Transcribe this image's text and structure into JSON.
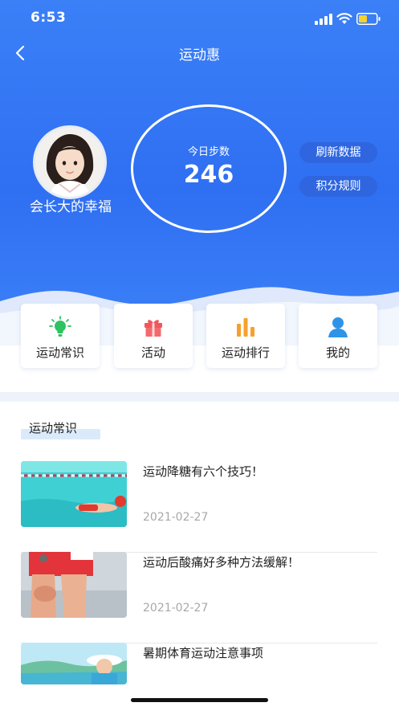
{
  "status_bar": {
    "time": "6:53"
  },
  "nav": {
    "title": "运动惠"
  },
  "profile": {
    "username": "会长大的幸福"
  },
  "steps": {
    "label": "今日步数",
    "value": "246"
  },
  "actions": {
    "refresh_label": "刷新数据",
    "rules_label": "积分规则"
  },
  "menu": [
    {
      "label": "运动常识",
      "icon": "lightbulb-icon",
      "color": "#2fc35f"
    },
    {
      "label": "活动",
      "icon": "gift-icon",
      "color": "#f0575b"
    },
    {
      "label": "运动排行",
      "icon": "bar-chart-icon",
      "color": "#f7a02b"
    },
    {
      "label": "我的",
      "icon": "user-icon",
      "color": "#2f94e8"
    }
  ],
  "section": {
    "title": "运动常识"
  },
  "articles": [
    {
      "title": "运动降糖有六个技巧！",
      "date": "2021-02-27"
    },
    {
      "title": "运动后酸痛好多种方法缓解！",
      "date": "2021-02-27"
    },
    {
      "title": "暑期体育运动注意事项",
      "date": ""
    }
  ],
  "colors": {
    "primary": "#3b7cf6",
    "pill": "#2f66e0"
  }
}
